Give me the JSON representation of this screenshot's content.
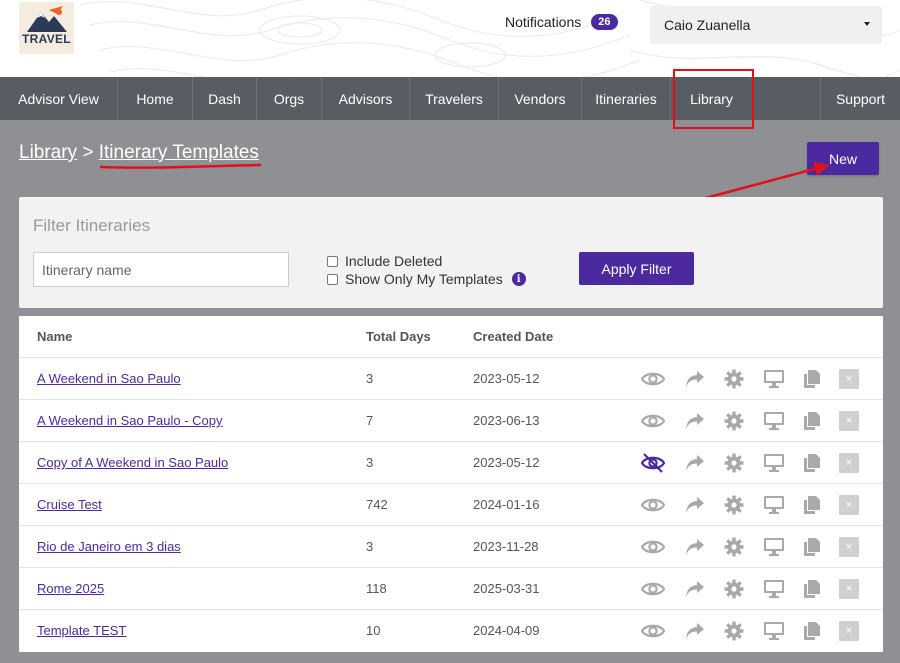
{
  "header": {
    "logo_text": "TRAVEL",
    "notifications_label": "Notifications",
    "notifications_count": "26",
    "user_name": "Caio Zuanella"
  },
  "nav": {
    "items": [
      "Advisor View",
      "Home",
      "Dash",
      "Orgs",
      "Advisors",
      "Travelers",
      "Vendors",
      "Itineraries",
      "Library",
      "Support"
    ]
  },
  "breadcrumb": {
    "root": "Library",
    "separator": ">",
    "current": "Itinerary Templates"
  },
  "new_button": "New",
  "filter": {
    "title": "Filter Itineraries",
    "name_placeholder": "Itinerary name",
    "include_deleted_label": "Include Deleted",
    "show_only_mine_label": "Show Only My Templates",
    "info_icon_glyph": "i",
    "apply_label": "Apply Filter"
  },
  "table": {
    "headers": {
      "name": "Name",
      "days": "Total Days",
      "date": "Created Date"
    },
    "rows": [
      {
        "name": "A Weekend in Sao Paulo",
        "days": "3",
        "date": "2023-05-12",
        "hidden": false
      },
      {
        "name": "A Weekend in Sao Paulo - Copy",
        "days": "7",
        "date": "2023-06-13",
        "hidden": false
      },
      {
        "name": "Copy of A Weekend in Sao Paulo",
        "days": "3",
        "date": "2023-05-12",
        "hidden": true
      },
      {
        "name": "Cruise Test",
        "days": "742",
        "date": "2024-01-16",
        "hidden": false
      },
      {
        "name": "Rio de Janeiro em 3 dias",
        "days": "3",
        "date": "2023-11-28",
        "hidden": false
      },
      {
        "name": "Rome 2025",
        "days": "118",
        "date": "2025-03-31",
        "hidden": false
      },
      {
        "name": "Template TEST",
        "days": "10",
        "date": "2024-04-09",
        "hidden": false
      }
    ],
    "delete_glyph": "×"
  },
  "colors": {
    "accent": "#4b2aa0",
    "nav_bg": "#585d63",
    "page_bg": "#8e9093",
    "annotation_red": "#e3101a",
    "icon_gray": "#a9a9a9"
  }
}
